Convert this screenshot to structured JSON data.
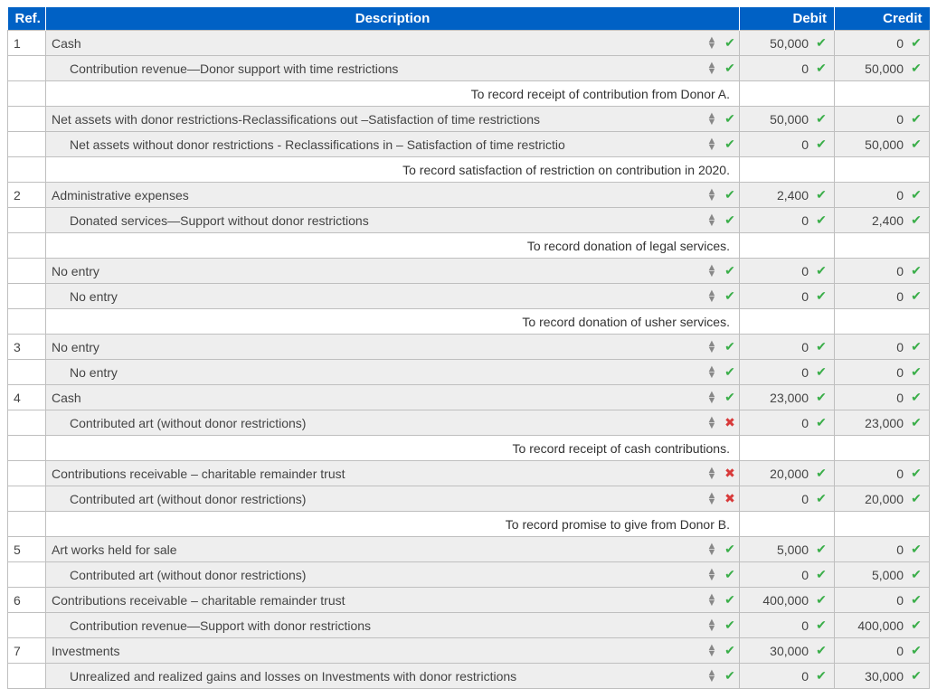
{
  "headers": {
    "ref": "Ref.",
    "desc": "Description",
    "debit": "Debit",
    "credit": "Credit"
  },
  "rows": [
    {
      "type": "entry",
      "ref": "1",
      "desc": "Cash",
      "indent": false,
      "descStatus": "ok",
      "debit": "50,000",
      "debitStatus": "ok",
      "credit": "0",
      "creditStatus": "ok"
    },
    {
      "type": "entry",
      "ref": "",
      "desc": "Contribution revenue—Donor support with time restrictions",
      "indent": true,
      "descStatus": "ok",
      "debit": "0",
      "debitStatus": "ok",
      "credit": "50,000",
      "creditStatus": "ok"
    },
    {
      "type": "note",
      "text": "To record receipt of contribution from Donor A."
    },
    {
      "type": "entry",
      "ref": "",
      "desc": "Net assets with donor restrictions-Reclassifications out –Satisfaction of time restrictions",
      "indent": false,
      "descStatus": "ok",
      "debit": "50,000",
      "debitStatus": "ok",
      "credit": "0",
      "creditStatus": "ok"
    },
    {
      "type": "entry",
      "ref": "",
      "desc": "Net assets without donor restrictions - Reclassifications in – Satisfaction of time restrictio",
      "indent": true,
      "descStatus": "ok",
      "debit": "0",
      "debitStatus": "ok",
      "credit": "50,000",
      "creditStatus": "ok"
    },
    {
      "type": "note",
      "text": "To record satisfaction of restriction on contribution in 2020."
    },
    {
      "type": "entry",
      "ref": "2",
      "desc": "Administrative expenses",
      "indent": false,
      "descStatus": "ok",
      "debit": "2,400",
      "debitStatus": "ok",
      "credit": "0",
      "creditStatus": "ok"
    },
    {
      "type": "entry",
      "ref": "",
      "desc": "Donated services—Support without donor restrictions",
      "indent": true,
      "descStatus": "ok",
      "debit": "0",
      "debitStatus": "ok",
      "credit": "2,400",
      "creditStatus": "ok"
    },
    {
      "type": "note",
      "text": "To record donation of legal services."
    },
    {
      "type": "entry",
      "ref": "",
      "desc": "No entry",
      "indent": false,
      "descStatus": "ok",
      "debit": "0",
      "debitStatus": "ok",
      "credit": "0",
      "creditStatus": "ok"
    },
    {
      "type": "entry",
      "ref": "",
      "desc": "No entry",
      "indent": true,
      "descStatus": "ok",
      "debit": "0",
      "debitStatus": "ok",
      "credit": "0",
      "creditStatus": "ok"
    },
    {
      "type": "note",
      "text": "To record donation of usher services."
    },
    {
      "type": "entry",
      "ref": "3",
      "desc": "No entry",
      "indent": false,
      "descStatus": "ok",
      "debit": "0",
      "debitStatus": "ok",
      "credit": "0",
      "creditStatus": "ok"
    },
    {
      "type": "entry",
      "ref": "",
      "desc": "No entry",
      "indent": true,
      "descStatus": "ok",
      "debit": "0",
      "debitStatus": "ok",
      "credit": "0",
      "creditStatus": "ok"
    },
    {
      "type": "entry",
      "ref": "4",
      "desc": "Cash",
      "indent": false,
      "descStatus": "ok",
      "debit": "23,000",
      "debitStatus": "ok",
      "credit": "0",
      "creditStatus": "ok"
    },
    {
      "type": "entry",
      "ref": "",
      "desc": "Contributed art (without donor restrictions)",
      "indent": true,
      "descStatus": "bad",
      "debit": "0",
      "debitStatus": "ok",
      "credit": "23,000",
      "creditStatus": "ok"
    },
    {
      "type": "note",
      "text": "To record receipt of cash contributions."
    },
    {
      "type": "entry",
      "ref": "",
      "desc": "Contributions receivable – charitable remainder trust",
      "indent": false,
      "descStatus": "bad",
      "debit": "20,000",
      "debitStatus": "ok",
      "credit": "0",
      "creditStatus": "ok"
    },
    {
      "type": "entry",
      "ref": "",
      "desc": "Contributed art (without donor restrictions)",
      "indent": true,
      "descStatus": "bad",
      "debit": "0",
      "debitStatus": "ok",
      "credit": "20,000",
      "creditStatus": "ok"
    },
    {
      "type": "note",
      "text": "To record promise to give from Donor B."
    },
    {
      "type": "entry",
      "ref": "5",
      "desc": "Art works held for sale",
      "indent": false,
      "descStatus": "ok",
      "debit": "5,000",
      "debitStatus": "ok",
      "credit": "0",
      "creditStatus": "ok"
    },
    {
      "type": "entry",
      "ref": "",
      "desc": "Contributed art (without donor restrictions)",
      "indent": true,
      "descStatus": "ok",
      "debit": "0",
      "debitStatus": "ok",
      "credit": "5,000",
      "creditStatus": "ok"
    },
    {
      "type": "entry",
      "ref": "6",
      "desc": "Contributions receivable – charitable remainder trust",
      "indent": false,
      "descStatus": "ok",
      "debit": "400,000",
      "debitStatus": "ok",
      "credit": "0",
      "creditStatus": "ok"
    },
    {
      "type": "entry",
      "ref": "",
      "desc": "Contribution revenue—Support with donor restrictions",
      "indent": true,
      "descStatus": "ok",
      "debit": "0",
      "debitStatus": "ok",
      "credit": "400,000",
      "creditStatus": "ok"
    },
    {
      "type": "entry",
      "ref": "7",
      "desc": "Investments",
      "indent": false,
      "descStatus": "ok",
      "debit": "30,000",
      "debitStatus": "ok",
      "credit": "0",
      "creditStatus": "ok"
    },
    {
      "type": "entry",
      "ref": "",
      "desc": "Unrealized and realized gains and losses on Investments with donor restrictions",
      "indent": true,
      "descStatus": "ok",
      "debit": "0",
      "debitStatus": "ok",
      "credit": "30,000",
      "creditStatus": "ok"
    }
  ]
}
